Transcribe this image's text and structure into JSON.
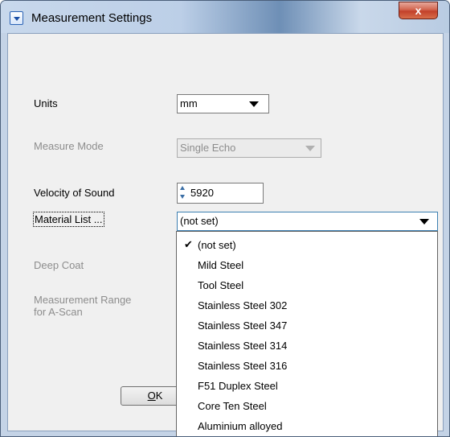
{
  "window": {
    "title": "Measurement Settings",
    "close_glyph": "x"
  },
  "form": {
    "units": {
      "label": "Units",
      "value": "mm"
    },
    "measure_mode": {
      "label": "Measure Mode",
      "value": "Single Echo",
      "disabled": true
    },
    "velocity": {
      "label": "Velocity of Sound",
      "value": "5920"
    },
    "material_list": {
      "label": "Material List ...",
      "value": "(not set)"
    },
    "deep_coat": {
      "label": "Deep Coat",
      "disabled": true
    },
    "measurement_range": {
      "label_line1": "Measurement Range",
      "label_line2": "for A-Scan",
      "disabled": true
    }
  },
  "buttons": {
    "ok_prefix": "O",
    "ok_rest": "K"
  },
  "dropdown": {
    "checkmark": "✔",
    "items": [
      "(not set)",
      "Mild Steel",
      "Tool Steel",
      "Stainless Steel 302",
      "Stainless Steel 347",
      "Stainless Steel 314",
      "Stainless Steel 316",
      "F51 Duplex Steel",
      "Core Ten Steel",
      "Aluminium alloyed"
    ],
    "selected_index": 0
  },
  "colors": {
    "title_bar": "#bccfe7",
    "close_button": "#c2402a",
    "dialog_bg": "#f0f0f0",
    "disabled_text": "#8d8d8d"
  }
}
